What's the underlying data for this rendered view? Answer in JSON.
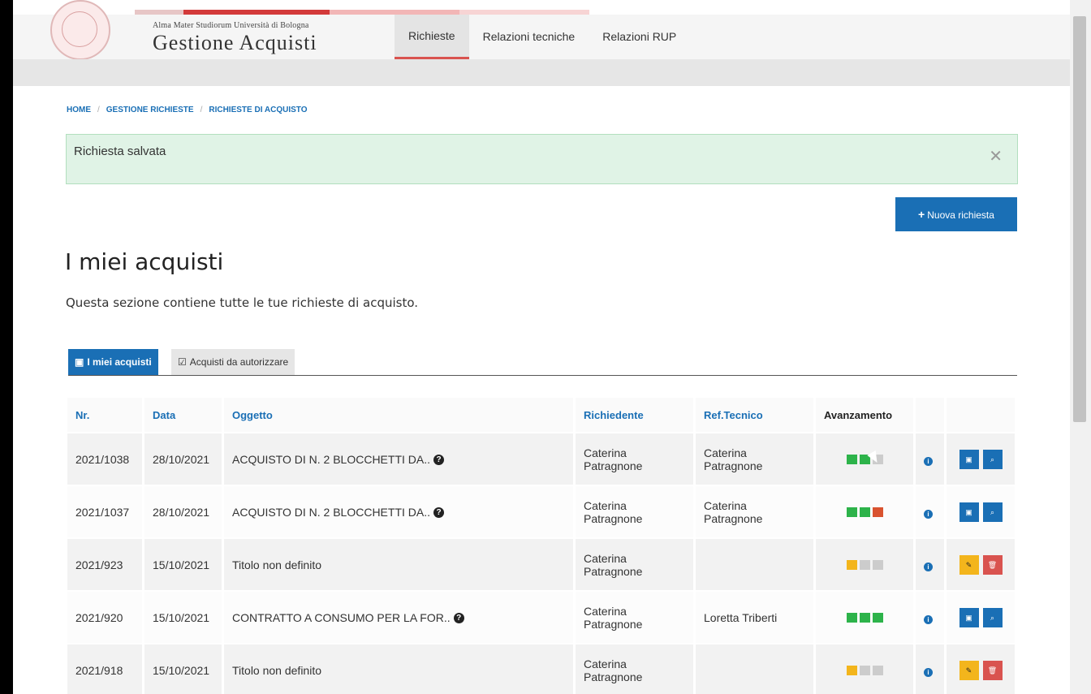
{
  "header": {
    "brand_small": "Alma Mater Studiorum Università di Bologna",
    "brand_big": "Gestione Acquisti",
    "nav": [
      "Richieste",
      "Relazioni tecniche",
      "Relazioni RUP"
    ],
    "stripe_colors": [
      "#e7c6c6",
      "#d33a3a",
      "#f2b6b6",
      "#f7d4d4"
    ]
  },
  "breadcrumb": [
    "HOME",
    "GESTIONE RICHIESTE",
    "RICHIESTE DI ACQUISTO"
  ],
  "alert": {
    "message": "Richiesta salvata",
    "close": "✕"
  },
  "new_button": {
    "icon": "plus-icon",
    "label": "Nuova richiesta"
  },
  "page": {
    "title": "I miei acquisti",
    "subtitle": "Questa sezione contiene tutte le tue richieste di acquisto."
  },
  "tabs": [
    {
      "label": "I miei acquisti",
      "icon": "basket-icon"
    },
    {
      "label": "Acquisti da autorizzare",
      "icon": "checkbox-icon"
    }
  ],
  "table": {
    "headers": [
      "Nr.",
      "Data",
      "Oggetto",
      "Richiedente",
      "Ref.Tecnico",
      "Avanzamento"
    ],
    "rows": [
      {
        "nr": "2021/1038",
        "data": "28/10/2021",
        "oggetto": "ACQUISTO DI N. 2 BLOCCHETTI DA..",
        "help": true,
        "rich1": "Caterina",
        "rich2": "Patragnone",
        "ref1": "Caterina",
        "ref2": "Patragnone",
        "progress": [
          "#2db34a",
          "#2db34a",
          "#cccccc"
        ],
        "actions": [
          "blue",
          "blue"
        ]
      },
      {
        "nr": "2021/1037",
        "data": "28/10/2021",
        "oggetto": "ACQUISTO DI N. 2 BLOCCHETTI DA..",
        "help": true,
        "rich1": "Caterina",
        "rich2": "Patragnone",
        "ref1": "Caterina",
        "ref2": "Patragnone",
        "progress": [
          "#2db34a",
          "#2db34a",
          "#d9532f"
        ],
        "actions": [
          "blue",
          "blue"
        ]
      },
      {
        "nr": "2021/923",
        "data": "15/10/2021",
        "oggetto": "Titolo non definito",
        "help": false,
        "rich1": "Caterina",
        "rich2": "Patragnone",
        "ref1": "",
        "ref2": "",
        "progress": [
          "#f3b51c",
          "#cccccc",
          "#cccccc"
        ],
        "actions": [
          "yellow",
          "red"
        ]
      },
      {
        "nr": "2021/920",
        "data": "15/10/2021",
        "oggetto": "CONTRATTO A CONSUMO PER LA FOR..",
        "help": true,
        "rich1": "Caterina",
        "rich2": "Patragnone",
        "ref1": "Loretta Triberti",
        "ref2": "",
        "progress": [
          "#2db34a",
          "#2db34a",
          "#2db34a"
        ],
        "actions": [
          "blue",
          "blue"
        ]
      },
      {
        "nr": "2021/918",
        "data": "15/10/2021",
        "oggetto": "Titolo non definito",
        "help": false,
        "rich1": "Caterina",
        "rich2": "Patragnone",
        "ref1": "",
        "ref2": "",
        "progress": [
          "#f3b51c",
          "#cccccc",
          "#cccccc"
        ],
        "actions": [
          "yellow",
          "red"
        ]
      }
    ]
  },
  "colors": {
    "accent": "#1a6fb5",
    "alert_bg": "#e0f3e6",
    "warning": "#f3b51c",
    "danger": "#d9534f",
    "success": "#2db34a"
  }
}
